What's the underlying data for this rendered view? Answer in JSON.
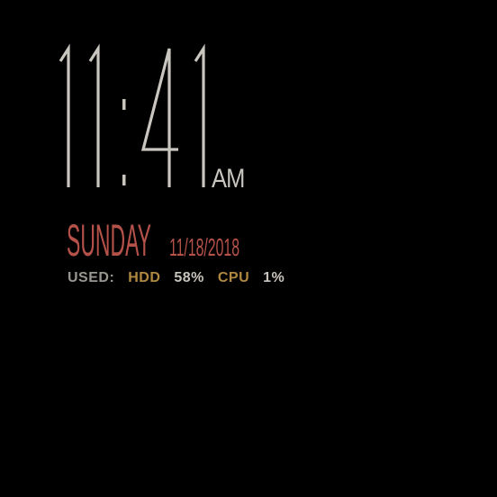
{
  "clock": {
    "time": "11:41",
    "meridiem": "AM"
  },
  "date": {
    "weekday": "SUNDAY",
    "date": "11/18/2018"
  },
  "stats": {
    "used_label": "USED:",
    "hdd_label": "HDD",
    "hdd_value": "58%",
    "cpu_label": "CPU",
    "cpu_value": "1%"
  },
  "colors": {
    "background": "#000000",
    "clock": "#c9c6c0",
    "weekday": "#b4524a",
    "date": "#b4524a",
    "label": "#9a9690",
    "accent": "#b08840",
    "value": "#c8c4bc"
  }
}
